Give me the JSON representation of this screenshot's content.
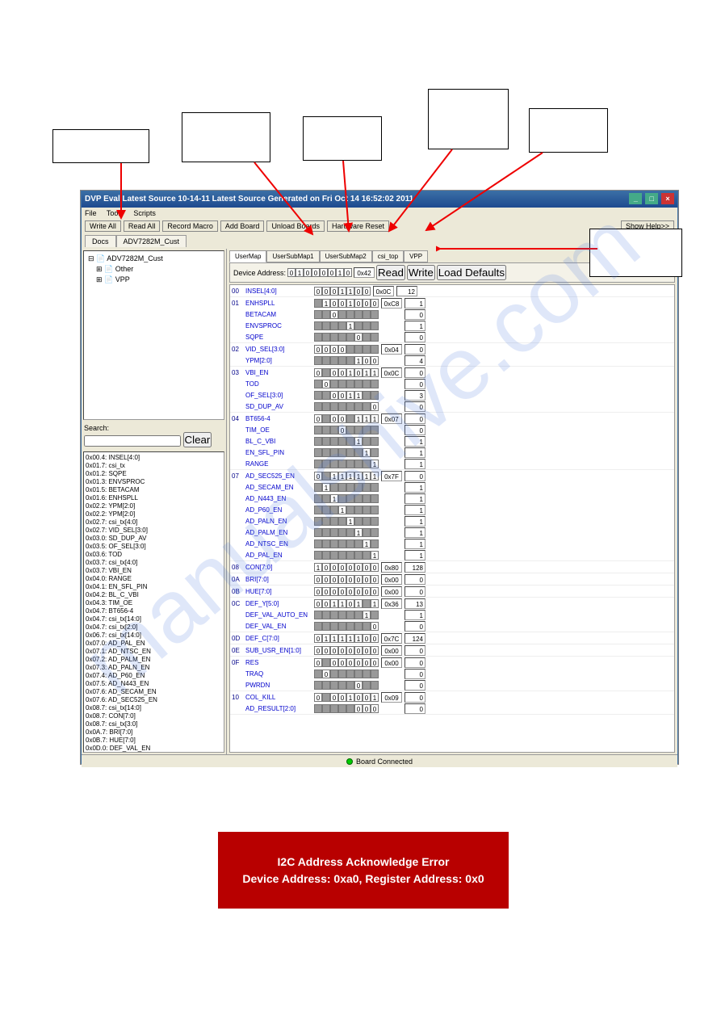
{
  "watermark": "manualshive.com",
  "window": {
    "title": "DVP Eval Latest Source 10-14-11 Latest Source Generated on Fri Oct 14 16:52:02 2011",
    "menu": [
      "File",
      "Tools",
      "Scripts"
    ],
    "toolbar": {
      "write_all": "Write All",
      "read_all": "Read All",
      "record_macro": "Record Macro",
      "add_board": "Add Board",
      "unload_boards": "Unload Boards",
      "hardware_reset": "Hardware Reset",
      "show_help": "Show Help>>"
    },
    "top_tabs": [
      "Docs",
      "ADV7282M_Cust"
    ],
    "tree": {
      "root": "ADV7282M_Cust",
      "children": [
        "Other",
        "VPP"
      ]
    },
    "search": {
      "label": "Search:",
      "clear": "Clear"
    },
    "search_items": [
      "0x00.4: INSEL[4:0]",
      "0x01.7: csi_tx",
      "0x01.2: SQPE",
      "0x01.3: ENVSPROC",
      "0x01.5: BETACAM",
      "0x01.6: ENHSPLL",
      "0x02.2: YPM[2:0]",
      "0x02.2: YPM[2:0]",
      "0x02.7: csi_tx[4:0]",
      "0x02.7: VID_SEL[3:0]",
      "0x03.0: SD_DUP_AV",
      "0x03.5: OF_SEL[3:0]",
      "0x03.6: TOD",
      "0x03.7: csi_tx[4:0]",
      "0x03.7: VBI_EN",
      "0x04.0: RANGE",
      "0x04.1: EN_SFL_PIN",
      "0x04.2: BL_C_VBI",
      "0x04.3: TIM_OE",
      "0x04.7: BT656-4",
      "0x04.7: csi_tx[14:0]",
      "0x04.7: csi_tx[2:0]",
      "0x06.7: csi_tx[14:0]",
      "0x07.0: AD_PAL_EN",
      "0x07.1: AD_NTSC_EN",
      "0x07.2: AD_PALM_EN",
      "0x07.3: AD_PALN_EN",
      "0x07.4: AD_P60_EN",
      "0x07.5: AD_N443_EN",
      "0x07.6: AD_SECAM_EN",
      "0x07.6: AD_SEC525_EN",
      "0x08.7: csi_tx[14:0]",
      "0x08.7: CON[7:0]",
      "0x08.7: csi_tx[3:0]",
      "0x0A.7: BRI[7:0]",
      "0x0B.7: HUE[7:0]",
      "0x0D.0: DEF_VAL_EN"
    ],
    "reg_tabs": [
      "UserMap",
      "UserSubMap1",
      "UserSubMap2",
      "csi_top",
      "VPP"
    ],
    "device_addr": {
      "label": "Device Address:",
      "bits": [
        "0",
        "1",
        "0",
        "0",
        "0",
        "0",
        "1",
        "0"
      ],
      "hex": "0x42",
      "read": "Read",
      "write": "Write",
      "load": "Load Defaults"
    },
    "registers": [
      {
        "addr": "00",
        "rows": [
          {
            "name": "INSEL[4:0]",
            "bits": [
              "0",
              "0",
              "0",
              "1",
              "1",
              "0",
              "0"
            ],
            "hex": "0x0C",
            "val": "12"
          }
        ]
      },
      {
        "addr": "01",
        "rows": [
          {
            "name": "ENHSPLL",
            "bits": [
              "",
              "1",
              "0",
              "0",
              "1",
              "0",
              "0",
              "0"
            ],
            "hex": "0xC8",
            "val": "1"
          },
          {
            "name": "BETACAM",
            "bits": [
              "",
              "",
              "0",
              "",
              "",
              "",
              "",
              ""
            ],
            "val": "0"
          },
          {
            "name": "ENVSPROC",
            "bits": [
              "",
              "",
              "",
              "",
              "1",
              "",
              "",
              ""
            ],
            "val": "1"
          },
          {
            "name": "SQPE",
            "bits": [
              "",
              "",
              "",
              "",
              "",
              "0",
              "",
              ""
            ],
            "val": "0"
          }
        ]
      },
      {
        "addr": "02",
        "rows": [
          {
            "name": "VID_SEL[3:0]",
            "bits": [
              "0",
              "0",
              "0",
              "0",
              "",
              "",
              "",
              ""
            ],
            "hex": "0x04",
            "val": "0"
          },
          {
            "name": "YPM[2:0]",
            "bits": [
              "",
              "",
              "",
              "",
              "",
              "1",
              "0",
              "0"
            ],
            "val": "4"
          }
        ]
      },
      {
        "addr": "03",
        "rows": [
          {
            "name": "VBI_EN",
            "bits": [
              "0",
              "",
              "0",
              "0",
              "1",
              "0",
              "1",
              "1"
            ],
            "hex": "0x0C",
            "val": "0"
          },
          {
            "name": "TOD",
            "bits": [
              "",
              "0",
              "",
              "",
              "",
              "",
              "",
              ""
            ],
            "val": "0"
          },
          {
            "name": "OF_SEL[3:0]",
            "bits": [
              "",
              "",
              "0",
              "0",
              "1",
              "1",
              "",
              ""
            ],
            "val": "3"
          },
          {
            "name": "SD_DUP_AV",
            "bits": [
              "",
              "",
              "",
              "",
              "",
              "",
              "",
              "0"
            ],
            "val": "0"
          }
        ]
      },
      {
        "addr": "04",
        "rows": [
          {
            "name": "BT656-4",
            "bits": [
              "0",
              "",
              "0",
              "0",
              "",
              "1",
              "1",
              "1"
            ],
            "hex": "0x07",
            "val": "0"
          },
          {
            "name": "TIM_OE",
            "bits": [
              "",
              "",
              "",
              "0",
              "",
              "",
              "",
              ""
            ],
            "val": "0"
          },
          {
            "name": "BL_C_VBI",
            "bits": [
              "",
              "",
              "",
              "",
              "",
              "1",
              "",
              ""
            ],
            "val": "1"
          },
          {
            "name": "EN_SFL_PIN",
            "bits": [
              "",
              "",
              "",
              "",
              "",
              "",
              "1",
              ""
            ],
            "val": "1"
          },
          {
            "name": "RANGE",
            "bits": [
              "",
              "",
              "",
              "",
              "",
              "",
              "",
              "1"
            ],
            "val": "1"
          }
        ]
      },
      {
        "addr": "07",
        "rows": [
          {
            "name": "AD_SEC525_EN",
            "bits": [
              "0",
              "",
              "1",
              "1",
              "1",
              "1",
              "1",
              "1"
            ],
            "hex": "0x7F",
            "val": "0"
          },
          {
            "name": "AD_SECAM_EN",
            "bits": [
              "",
              "1",
              "",
              "",
              "",
              "",
              "",
              ""
            ],
            "val": "1"
          },
          {
            "name": "AD_N443_EN",
            "bits": [
              "",
              "",
              "1",
              "",
              "",
              "",
              "",
              ""
            ],
            "val": "1"
          },
          {
            "name": "AD_P60_EN",
            "bits": [
              "",
              "",
              "",
              "1",
              "",
              "",
              "",
              ""
            ],
            "val": "1"
          },
          {
            "name": "AD_PALN_EN",
            "bits": [
              "",
              "",
              "",
              "",
              "1",
              "",
              "",
              ""
            ],
            "val": "1"
          },
          {
            "name": "AD_PALM_EN",
            "bits": [
              "",
              "",
              "",
              "",
              "",
              "1",
              "",
              ""
            ],
            "val": "1"
          },
          {
            "name": "AD_NTSC_EN",
            "bits": [
              "",
              "",
              "",
              "",
              "",
              "",
              "1",
              ""
            ],
            "val": "1"
          },
          {
            "name": "AD_PAL_EN",
            "bits": [
              "",
              "",
              "",
              "",
              "",
              "",
              "",
              "1"
            ],
            "val": "1"
          }
        ]
      },
      {
        "addr": "08",
        "rows": [
          {
            "name": "CON[7:0]",
            "bits": [
              "1",
              "0",
              "0",
              "0",
              "0",
              "0",
              "0",
              "0"
            ],
            "hex": "0x80",
            "val": "128"
          }
        ]
      },
      {
        "addr": "0A",
        "rows": [
          {
            "name": "BRI[7:0]",
            "bits": [
              "0",
              "0",
              "0",
              "0",
              "0",
              "0",
              "0",
              "0"
            ],
            "hex": "0x00",
            "val": "0"
          }
        ]
      },
      {
        "addr": "0B",
        "rows": [
          {
            "name": "HUE[7:0]",
            "bits": [
              "0",
              "0",
              "0",
              "0",
              "0",
              "0",
              "0",
              "0"
            ],
            "hex": "0x00",
            "val": "0"
          }
        ]
      },
      {
        "addr": "0C",
        "rows": [
          {
            "name": "DEF_Y[5:0]",
            "bits": [
              "0",
              "0",
              "1",
              "1",
              "0",
              "1",
              "",
              "1"
            ],
            "hex": "0x36",
            "val": "13"
          },
          {
            "name": "DEF_VAL_AUTO_EN",
            "bits": [
              "",
              "",
              "",
              "",
              "",
              "",
              "1",
              ""
            ],
            "val": "1"
          },
          {
            "name": "DEF_VAL_EN",
            "bits": [
              "",
              "",
              "",
              "",
              "",
              "",
              "",
              "0"
            ],
            "val": "0"
          }
        ]
      },
      {
        "addr": "0D",
        "rows": [
          {
            "name": "DEF_C[7:0]",
            "bits": [
              "0",
              "1",
              "1",
              "1",
              "1",
              "1",
              "0",
              "0"
            ],
            "hex": "0x7C",
            "val": "124"
          }
        ]
      },
      {
        "addr": "0E",
        "rows": [
          {
            "name": "SUB_USR_EN[1:0]",
            "bits": [
              "0",
              "0",
              "0",
              "0",
              "0",
              "0",
              "0",
              "0"
            ],
            "hex": "0x00",
            "val": "0"
          }
        ]
      },
      {
        "addr": "0F",
        "rows": [
          {
            "name": "RES",
            "bits": [
              "0",
              "",
              "0",
              "0",
              "0",
              "0",
              "0",
              "0"
            ],
            "hex": "0x00",
            "val": "0"
          },
          {
            "name": "TRAQ",
            "bits": [
              "",
              "0",
              "",
              "",
              "",
              "",
              "",
              ""
            ],
            "val": "0"
          },
          {
            "name": "PWRDN",
            "bits": [
              "",
              "",
              "",
              "",
              "",
              "0",
              "",
              ""
            ],
            "val": "0"
          }
        ]
      },
      {
        "addr": "10",
        "rows": [
          {
            "name": "COL_KILL",
            "bits": [
              "0",
              "",
              "0",
              "0",
              "1",
              "0",
              "0",
              "1"
            ],
            "hex": "0x09",
            "val": "0"
          },
          {
            "name": "AD_RESULT[2:0]",
            "bits": [
              "",
              "",
              "",
              "",
              "",
              "0",
              "0",
              "0"
            ],
            "val": "0"
          }
        ]
      }
    ],
    "status": "Board Connected"
  },
  "error": {
    "line1": "I2C Address Acknowledge Error",
    "line2": "Device Address: 0xa0, Register Address: 0x0"
  }
}
